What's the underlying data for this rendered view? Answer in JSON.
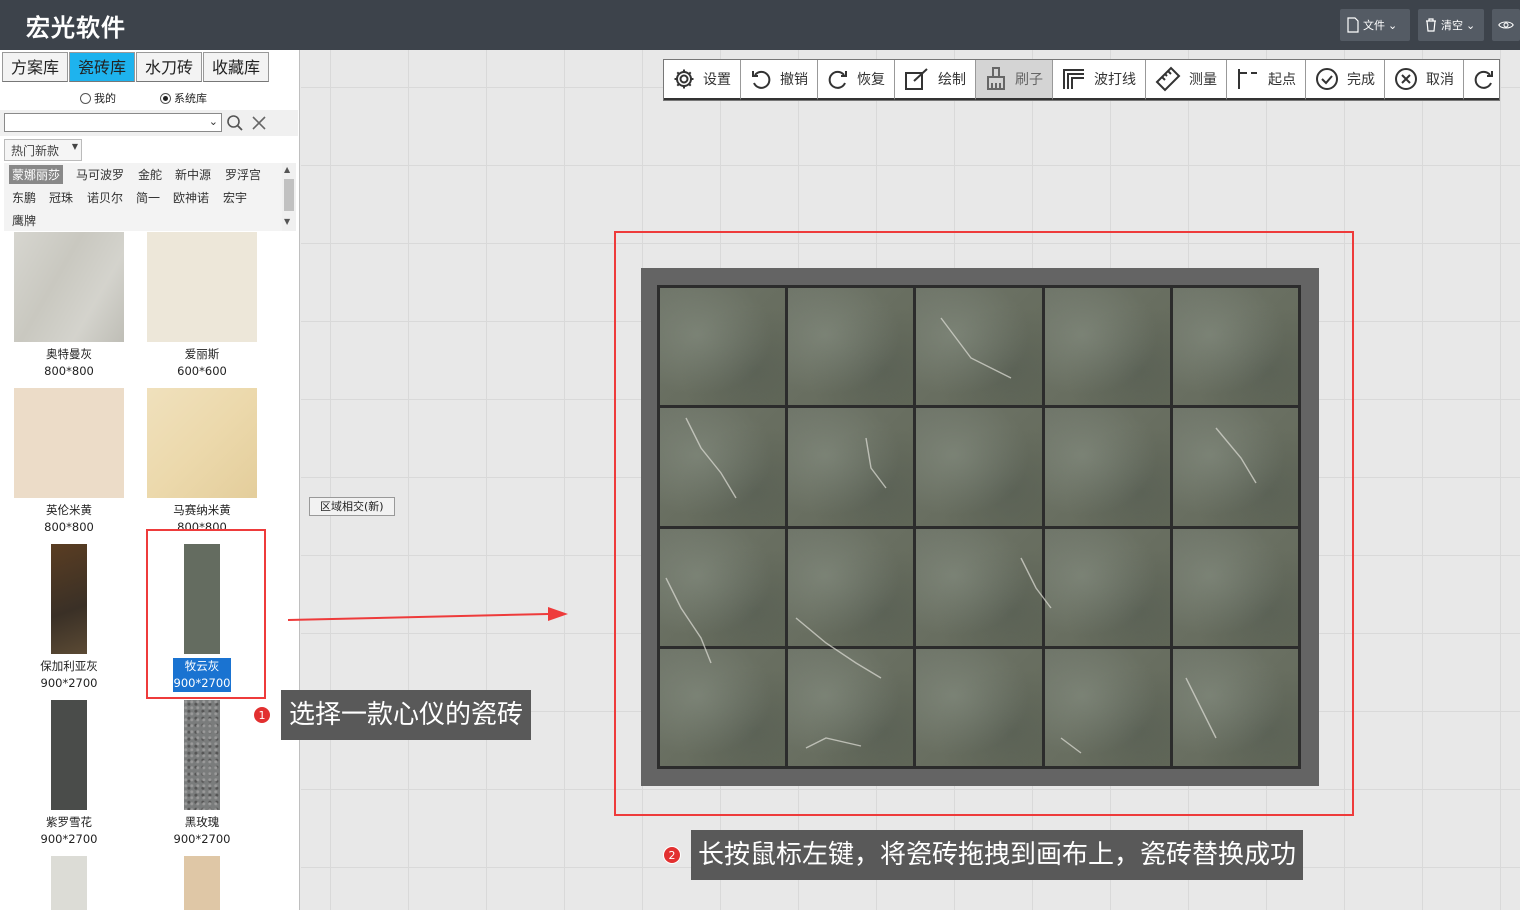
{
  "app": {
    "title": "宏光软件"
  },
  "titlebar": {
    "file_label": "文件",
    "clear_label": "清空"
  },
  "left": {
    "tabs": [
      {
        "label": "方案库"
      },
      {
        "label": "瓷砖库"
      },
      {
        "label": "水刀砖"
      },
      {
        "label": "收藏库"
      }
    ],
    "radio_mine": "我的",
    "radio_system": "系统库",
    "search_value": "",
    "hot_select": "热门新款",
    "brands": [
      {
        "label": "蒙娜丽莎"
      },
      {
        "label": "马可波罗"
      },
      {
        "label": "金舵"
      },
      {
        "label": "新中源"
      },
      {
        "label": "罗浮宫"
      },
      {
        "label": "东鹏"
      },
      {
        "label": "冠珠"
      },
      {
        "label": "诺贝尔"
      },
      {
        "label": "简一"
      },
      {
        "label": "欧神诺"
      },
      {
        "label": "宏宇"
      },
      {
        "label": "鹰牌"
      }
    ],
    "tiles": [
      {
        "name": "奥特曼灰",
        "size": "800*800",
        "color": "#c9c8c0"
      },
      {
        "name": "爱丽斯",
        "size": "600*600",
        "color": "#ede7d9"
      },
      {
        "name": "英伦米黄",
        "size": "800*800",
        "color": "#ecdcc8"
      },
      {
        "name": "马赛纳米黄",
        "size": "800*800",
        "color": "#ecd9ac"
      },
      {
        "name": "保加利亚灰",
        "size": "900*2700",
        "color": "#4a3a2a"
      },
      {
        "name": "牧云灰",
        "size": "900*2700",
        "color": "#646c60"
      },
      {
        "name": "紫罗雪花",
        "size": "900*2700",
        "color": "#4a4c4a"
      },
      {
        "name": "黑玫瑰",
        "size": "900*2700",
        "color": "#7a7c7c"
      },
      {
        "name": "",
        "size": "",
        "color": "#dcdcd6"
      },
      {
        "name": "",
        "size": "",
        "color": "#dfc7a6"
      }
    ]
  },
  "toolbar": {
    "items": [
      {
        "label": "设置",
        "icon": "gear-icon"
      },
      {
        "label": "撤销",
        "icon": "undo-icon"
      },
      {
        "label": "恢复",
        "icon": "redo-icon"
      },
      {
        "label": "绘制",
        "icon": "draw-icon"
      },
      {
        "label": "刷子",
        "icon": "brush-icon"
      },
      {
        "label": "波打线",
        "icon": "border-line-icon"
      },
      {
        "label": "测量",
        "icon": "ruler-icon"
      },
      {
        "label": "起点",
        "icon": "start-point-icon"
      },
      {
        "label": "完成",
        "icon": "check-icon"
      },
      {
        "label": "取消",
        "icon": "cancel-icon"
      }
    ]
  },
  "canvas": {
    "region_button": "区域相交(新)"
  },
  "annotations": {
    "step1_number": "1",
    "step1_text": "选择一款心仪的瓷砖",
    "step2_number": "2",
    "step2_text": "长按鼠标左键，将瓷砖拖拽到画布上，瓷砖替换成功"
  },
  "colors": {
    "accent_tab": "#1eb3ee",
    "highlight_red": "#ee3b3b",
    "selected_blue": "#1a73d1",
    "titlebar": "#3d434b"
  }
}
